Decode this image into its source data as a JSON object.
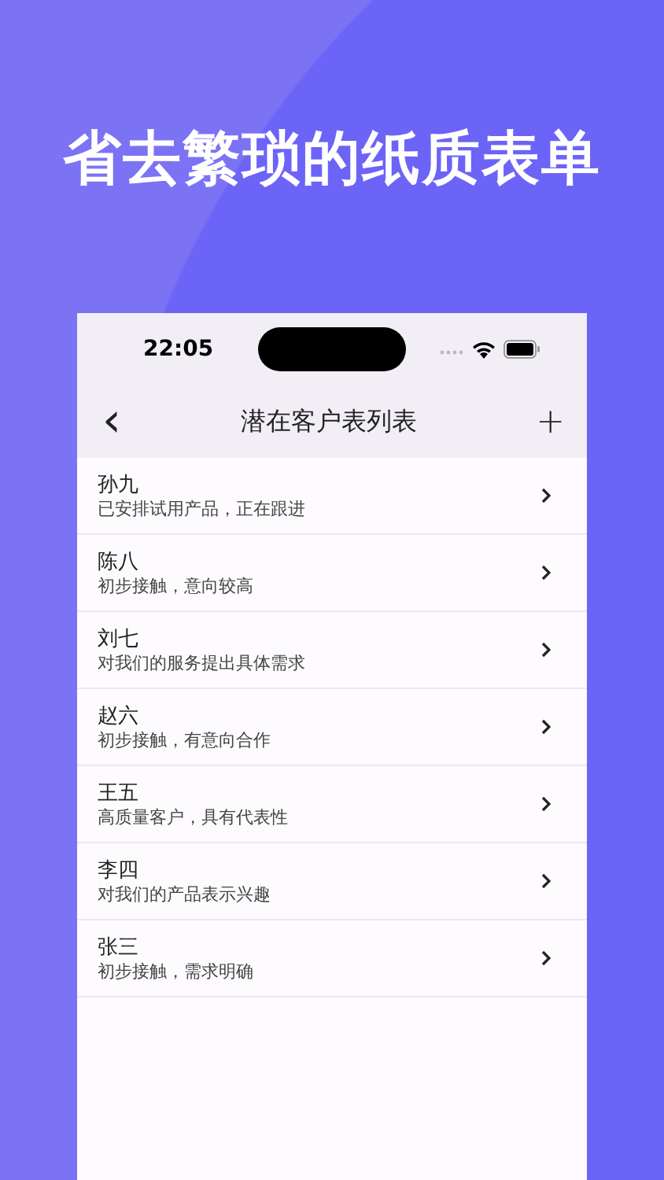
{
  "headline": "省去繁琐的纸质表单",
  "status_bar": {
    "time": "22:05"
  },
  "nav": {
    "back": "‹",
    "title": "潜在客户表列表",
    "add": "+"
  },
  "customers": [
    {
      "name": "孙九",
      "note": "已安排试用产品，正在跟进"
    },
    {
      "name": "陈八",
      "note": "初步接触，意向较高"
    },
    {
      "name": "刘七",
      "note": "对我们的服务提出具体需求"
    },
    {
      "name": "赵六",
      "note": "初步接触，有意向合作"
    },
    {
      "name": "王五",
      "note": "高质量客户，具有代表性"
    },
    {
      "name": "李四",
      "note": "对我们的产品表示兴趣"
    },
    {
      "name": "张三",
      "note": "初步接触，需求明确"
    }
  ]
}
